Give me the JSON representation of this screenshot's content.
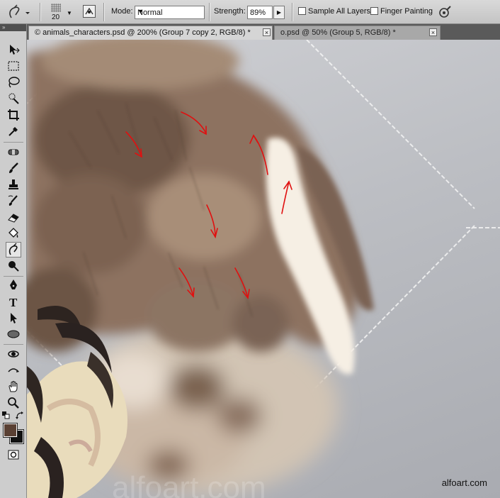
{
  "options_bar": {
    "brush_size": "20",
    "mode_label": "Mode:",
    "mode_value": "Normal",
    "strength_label": "Strength:",
    "strength_value": "89%",
    "sample_all_layers_label": "Sample All Layers",
    "sample_all_layers_checked": false,
    "finger_painting_label": "Finger Painting",
    "finger_painting_checked": false
  },
  "toolbox": {
    "header": "»",
    "active_tool": "smudge-tool",
    "foreground_color": "#5a4033",
    "background_color": "#111111"
  },
  "tabs": [
    {
      "label": "© animals_characters.psd @ 200% (Group 7 copy 2, RGB/8) *",
      "close": "×",
      "active": true
    },
    {
      "label": "o.psd @ 50% (Group 5, RGB/8) *",
      "close": "×",
      "active": false
    }
  ],
  "canvas": {
    "watermark": "alfoart.com",
    "arrow_color": "#e01010"
  }
}
